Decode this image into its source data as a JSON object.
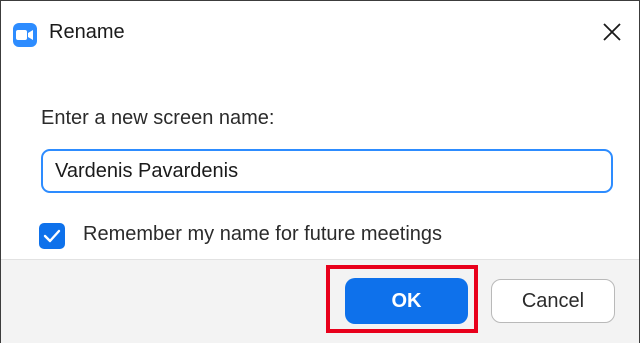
{
  "dialog": {
    "title": "Rename",
    "app_icon": "zoom-camera-icon",
    "close_icon": "close-icon"
  },
  "form": {
    "prompt": "Enter a new screen name:",
    "name_value": "Vardenis Pavardenis",
    "remember_checked": true,
    "remember_label": "Remember my name for future meetings"
  },
  "buttons": {
    "ok_label": "OK",
    "cancel_label": "Cancel"
  },
  "colors": {
    "accent": "#0e71eb",
    "input_border": "#2d8cff",
    "highlight": "#e8001b"
  }
}
